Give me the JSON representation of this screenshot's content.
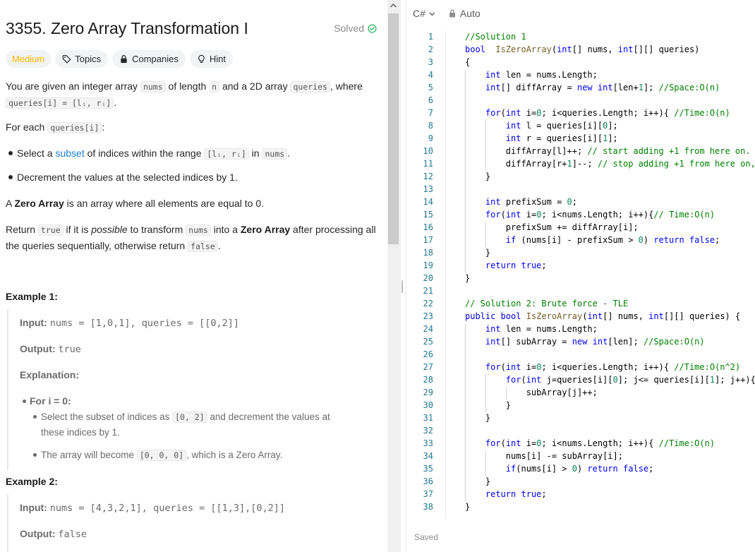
{
  "problem": {
    "title": "3355. Zero Array Transformation I",
    "solved_label": "Solved",
    "tags": [
      {
        "label": "Medium"
      },
      {
        "label": "Topics",
        "icon": "tag-icon"
      },
      {
        "label": "Companies",
        "icon": "lock-icon"
      },
      {
        "label": "Hint",
        "icon": "lightbulb-icon"
      }
    ],
    "desc": {
      "p1_a": "You are given an integer array ",
      "p1_nums": "nums",
      "p1_b": " of length ",
      "p1_n": "n",
      "p1_c": " and a 2D array ",
      "p1_queries": "queries",
      "p1_d": ", where",
      "p1_code2": "queries[i] = [lᵢ, rᵢ]",
      "p1_e": ".",
      "p2_a": "For each ",
      "p2_code": "queries[i]",
      "p2_b": ":",
      "b1_a": "Select a ",
      "b1_link": "subset",
      "b1_b": " of indices within the range ",
      "b1_code": "[lᵢ, rᵢ]",
      "b1_c": " in ",
      "b1_nums": "nums",
      "b1_d": ".",
      "b2": "Decrement the values at the selected indices by 1.",
      "p3_a": "A ",
      "p3_bold": "Zero Array",
      "p3_b": " is an array where all elements are equal to 0.",
      "p4_a": "Return ",
      "p4_true": "true",
      "p4_b": " if it is ",
      "p4_possible": "possible",
      "p4_c": " to transform ",
      "p4_nums": "nums",
      "p4_d": " into a ",
      "p4_bold": "Zero Array",
      "p4_e": " after processing all",
      "p4_f": "the queries sequentially, otherwise return ",
      "p4_false": "false",
      "p4_g": "."
    },
    "example1": {
      "heading": "Example 1:",
      "input_label": "Input:",
      "input_value": "nums = [1,0,1], queries = [[0,2]]",
      "output_label": "Output:",
      "output_value": "true",
      "explanation_label": "Explanation:",
      "for_label": "For i = 0:",
      "sub1_a": "Select the subset of indices as ",
      "sub1_code": "[0, 2]",
      "sub1_b": " and decrement the values at",
      "sub1_c": "these indices by 1.",
      "sub2_a": "The array will become ",
      "sub2_code": "[0, 0, 0]",
      "sub2_b": ", which is a Zero Array."
    },
    "example2": {
      "heading": "Example 2:",
      "input_label": "Input:",
      "input_value": "nums = [4,3,2,1], queries = [[1,3],[0,2]]",
      "output_label": "Output:",
      "output_value": "false"
    }
  },
  "editor": {
    "language": "C#",
    "mode": "Auto",
    "status": "Saved",
    "line_numbers": [
      "1",
      "2",
      "3",
      "4",
      "5",
      "6",
      "7",
      "8",
      "9",
      "10",
      "11",
      "12",
      "13",
      "14",
      "15",
      "16",
      "17",
      "18",
      "19",
      "20",
      "21",
      "22",
      "23",
      "24",
      "25",
      "26",
      "27",
      "28",
      "29",
      "30",
      "31",
      "32",
      "33",
      "34",
      "35",
      "36",
      "37",
      "38"
    ],
    "lines": [
      [
        [
          "cm",
          "//Solution 1"
        ]
      ],
      [
        [
          "ty",
          "bool"
        ],
        [
          "",
          "  "
        ],
        [
          "fn",
          "IsZeroArray"
        ],
        [
          "",
          "("
        ],
        [
          "ty",
          "int"
        ],
        [
          "",
          "[] nums, "
        ],
        [
          "ty",
          "int"
        ],
        [
          "",
          "[][] queries)"
        ]
      ],
      [
        [
          "",
          "{"
        ]
      ],
      [
        [
          "",
          "    "
        ],
        [
          "ty",
          "int"
        ],
        [
          "",
          " len = nums.Length;"
        ]
      ],
      [
        [
          "",
          "    "
        ],
        [
          "ty",
          "int"
        ],
        [
          "",
          "[] diffArray = "
        ],
        [
          "kw",
          "new"
        ],
        [
          "",
          " "
        ],
        [
          "ty",
          "int"
        ],
        [
          "",
          "[len+"
        ],
        [
          "nm",
          "1"
        ],
        [
          "",
          "]; "
        ],
        [
          "cm",
          "//Space:O(n)"
        ]
      ],
      [
        [
          "",
          ""
        ]
      ],
      [
        [
          "",
          "    "
        ],
        [
          "kw",
          "for"
        ],
        [
          "",
          "("
        ],
        [
          "ty",
          "int"
        ],
        [
          "",
          " i="
        ],
        [
          "nm",
          "0"
        ],
        [
          "",
          "; i<queries.Length; i++){ "
        ],
        [
          "cm",
          "//Time:O(n)"
        ]
      ],
      [
        [
          "",
          "        "
        ],
        [
          "ty",
          "int"
        ],
        [
          "",
          " l = queries[i]["
        ],
        [
          "nm",
          "0"
        ],
        [
          "",
          "];"
        ]
      ],
      [
        [
          "",
          "        "
        ],
        [
          "ty",
          "int"
        ],
        [
          "",
          " r = queries[i]["
        ],
        [
          "nm",
          "1"
        ],
        [
          "",
          "];"
        ]
      ],
      [
        [
          "",
          "        diffArray[l]++; "
        ],
        [
          "cm",
          "// start adding +1 from here on."
        ]
      ],
      [
        [
          "",
          "        diffArray[r+"
        ],
        [
          "nm",
          "1"
        ],
        [
          "",
          "]--; "
        ],
        [
          "cm",
          "// stop adding +1 from here on,"
        ]
      ],
      [
        [
          "",
          "    }"
        ]
      ],
      [
        [
          "",
          ""
        ]
      ],
      [
        [
          "",
          "    "
        ],
        [
          "ty",
          "int"
        ],
        [
          "",
          " prefixSum = "
        ],
        [
          "nm",
          "0"
        ],
        [
          "",
          ";"
        ]
      ],
      [
        [
          "",
          "    "
        ],
        [
          "kw",
          "for"
        ],
        [
          "",
          "("
        ],
        [
          "ty",
          "int"
        ],
        [
          "",
          " i="
        ],
        [
          "nm",
          "0"
        ],
        [
          "",
          "; i<nums.Length; i++){"
        ],
        [
          "cm",
          "// Time:O(n)"
        ]
      ],
      [
        [
          "",
          "        prefixSum += diffArray[i];"
        ]
      ],
      [
        [
          "",
          "        "
        ],
        [
          "kw",
          "if"
        ],
        [
          "",
          " (nums[i] - prefixSum > "
        ],
        [
          "nm",
          "0"
        ],
        [
          "",
          ") "
        ],
        [
          "kw",
          "return"
        ],
        [
          "",
          " "
        ],
        [
          "kw",
          "false"
        ],
        [
          "",
          ";"
        ]
      ],
      [
        [
          "",
          "    }"
        ]
      ],
      [
        [
          "",
          "    "
        ],
        [
          "kw",
          "return"
        ],
        [
          "",
          " "
        ],
        [
          "kw",
          "true"
        ],
        [
          "",
          ";"
        ]
      ],
      [
        [
          "",
          "}"
        ]
      ],
      [
        [
          "",
          ""
        ]
      ],
      [
        [
          "cm",
          "// Solution 2: Brute force - TLE"
        ]
      ],
      [
        [
          "kw",
          "public"
        ],
        [
          "",
          " "
        ],
        [
          "ty",
          "bool"
        ],
        [
          "",
          " "
        ],
        [
          "fn",
          "IsZeroArray"
        ],
        [
          "",
          "("
        ],
        [
          "ty",
          "int"
        ],
        [
          "",
          "[] nums, "
        ],
        [
          "ty",
          "int"
        ],
        [
          "",
          "[][] queries) {"
        ]
      ],
      [
        [
          "",
          "    "
        ],
        [
          "ty",
          "int"
        ],
        [
          "",
          " len = nums.Length;"
        ]
      ],
      [
        [
          "",
          "    "
        ],
        [
          "ty",
          "int"
        ],
        [
          "",
          "[] subArray = "
        ],
        [
          "kw",
          "new"
        ],
        [
          "",
          " "
        ],
        [
          "ty",
          "int"
        ],
        [
          "",
          "[len]; "
        ],
        [
          "cm",
          "//Space:O(n)"
        ]
      ],
      [
        [
          "",
          ""
        ]
      ],
      [
        [
          "",
          "    "
        ],
        [
          "kw",
          "for"
        ],
        [
          "",
          "("
        ],
        [
          "ty",
          "int"
        ],
        [
          "",
          " i="
        ],
        [
          "nm",
          "0"
        ],
        [
          "",
          "; i<queries.Length; i++){ "
        ],
        [
          "cm",
          "//Time:O(n^2)"
        ]
      ],
      [
        [
          "",
          "        "
        ],
        [
          "kw",
          "for"
        ],
        [
          "",
          "("
        ],
        [
          "ty",
          "int"
        ],
        [
          "",
          " j=queries[i]["
        ],
        [
          "nm",
          "0"
        ],
        [
          "",
          "]; j<= queries[i]["
        ],
        [
          "nm",
          "1"
        ],
        [
          "",
          "]; j++){"
        ]
      ],
      [
        [
          "",
          "            subArray[j]++;"
        ]
      ],
      [
        [
          "",
          "        }"
        ]
      ],
      [
        [
          "",
          "    }"
        ]
      ],
      [
        [
          "",
          ""
        ]
      ],
      [
        [
          "",
          "    "
        ],
        [
          "kw",
          "for"
        ],
        [
          "",
          "("
        ],
        [
          "ty",
          "int"
        ],
        [
          "",
          " i="
        ],
        [
          "nm",
          "0"
        ],
        [
          "",
          "; i<nums.Length; i++){ "
        ],
        [
          "cm",
          "//Time:O(n)"
        ]
      ],
      [
        [
          "",
          "        nums[i] -= subArray[i];"
        ]
      ],
      [
        [
          "",
          "        "
        ],
        [
          "kw",
          "if"
        ],
        [
          "",
          "(nums[i] > "
        ],
        [
          "nm",
          "0"
        ],
        [
          "",
          ") "
        ],
        [
          "kw",
          "return"
        ],
        [
          "",
          " "
        ],
        [
          "kw",
          "false"
        ],
        [
          "",
          ";"
        ]
      ],
      [
        [
          "",
          "    }"
        ]
      ],
      [
        [
          "",
          "    "
        ],
        [
          "kw",
          "return"
        ],
        [
          "",
          " "
        ],
        [
          "kw",
          "true"
        ],
        [
          "",
          ";"
        ]
      ],
      [
        [
          "",
          "}"
        ]
      ]
    ]
  },
  "colors": {
    "medium": "#ffb800",
    "solved_check": "#2db55d",
    "link": "#1a7fd6",
    "line_number": "#237893",
    "keyword": "#0000ff",
    "comment": "#008000",
    "number": "#098658",
    "function": "#795e26"
  }
}
